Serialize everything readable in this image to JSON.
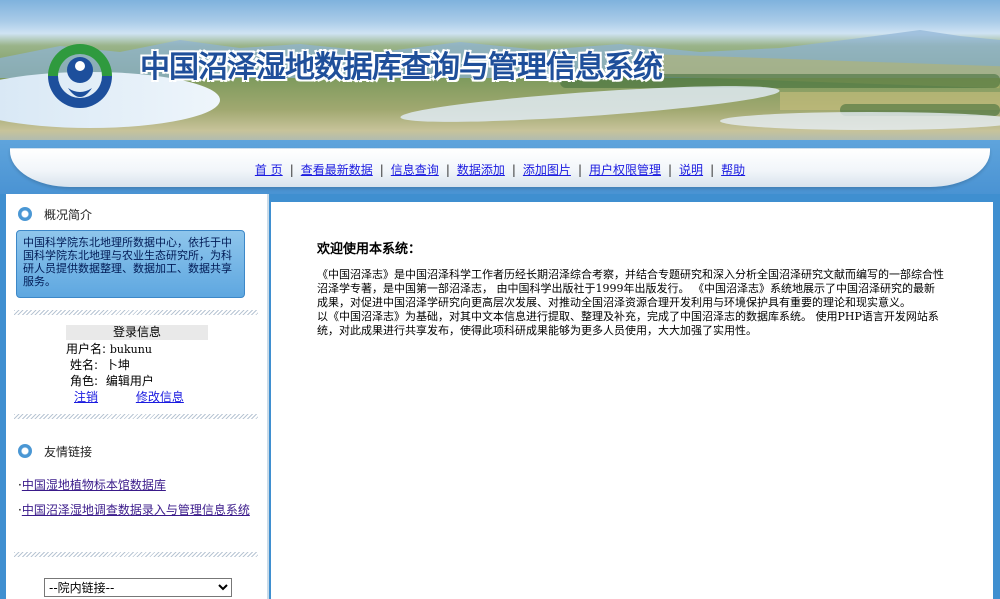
{
  "header": {
    "title": "中国沼泽湿地数据库查询与管理信息系统"
  },
  "nav": {
    "items": [
      "首 页",
      "查看最新数据",
      "信息查询",
      "数据添加",
      "添加图片",
      "用户权限管理",
      "说明",
      "帮助"
    ],
    "separator": "|"
  },
  "sidebar": {
    "overview": {
      "title": "概况简介",
      "text": "中国科学院东北地理所数据中心，依托于中国科学院东北地理与农业生态研究所，为科研人员提供数据整理、数据加工、数据共享服务。"
    },
    "login": {
      "title": "登录信息",
      "username_label": "用户名:",
      "username": "bukunu",
      "name_label": "姓名:",
      "name": "卜坤",
      "role_label": "角色:",
      "role": "编辑用户",
      "logout": "注销",
      "edit": "修改信息"
    },
    "friends": {
      "title": "友情链接",
      "bullet": "·",
      "links": [
        "中国湿地植物标本馆数据库",
        "中国沼泽湿地调查数据录入与管理信息系统"
      ]
    },
    "inner_links": {
      "selected": "--院内链接--"
    }
  },
  "main": {
    "welcome": "欢迎使用本系统：",
    "paragraphs": [
      "《中国沼泽志》是中国沼泽科学工作者历经长期沼泽综合考察，并结合专题研究和深入分析全国沼泽研究文献而编写的一部综合性沼泽学专著，是中国第一部沼泽志， 由中国科学出版社于1999年出版发行。 《中国沼泽志》系统地展示了中国沼泽研究的最新成果，对促进中国沼泽学研究向更高层次发展、对推动全国沼泽资源合理开发利用与环境保护具有重要的理论和现实意义。",
      "以《中国沼泽志》为基础，对其中文本信息进行提取、整理及补充，完成了中国沼泽志的数据库系统。 使用PHP语言开发网站系统，对此成果进行共享发布，使得此项科研成果能够为更多人员使用，大大加强了实用性。"
    ]
  },
  "colors": {
    "accent": "#4a93d3",
    "title": "#1f4f9a",
    "link": "#1b1be0"
  }
}
